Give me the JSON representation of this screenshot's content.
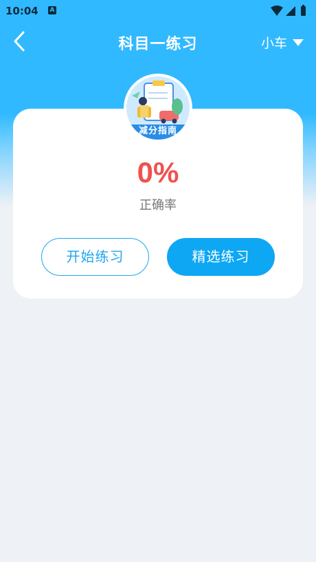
{
  "status_bar": {
    "time": "10:04",
    "notification_icon": "A"
  },
  "header": {
    "title": "科目一练习",
    "back_icon": "chevron-left-icon",
    "vehicle_type": "小车",
    "dropdown_icon": "caret-down-icon"
  },
  "card": {
    "badge_label": "减分指南",
    "accuracy_value": "0%",
    "accuracy_label": "正确率",
    "start_button": "开始练习",
    "select_button": "精选练习"
  },
  "colors": {
    "header_blue": "#30b9ff",
    "accent_red": "#f0514f",
    "button_blue": "#0ea7f3",
    "page_bg": "#eef1f6"
  }
}
